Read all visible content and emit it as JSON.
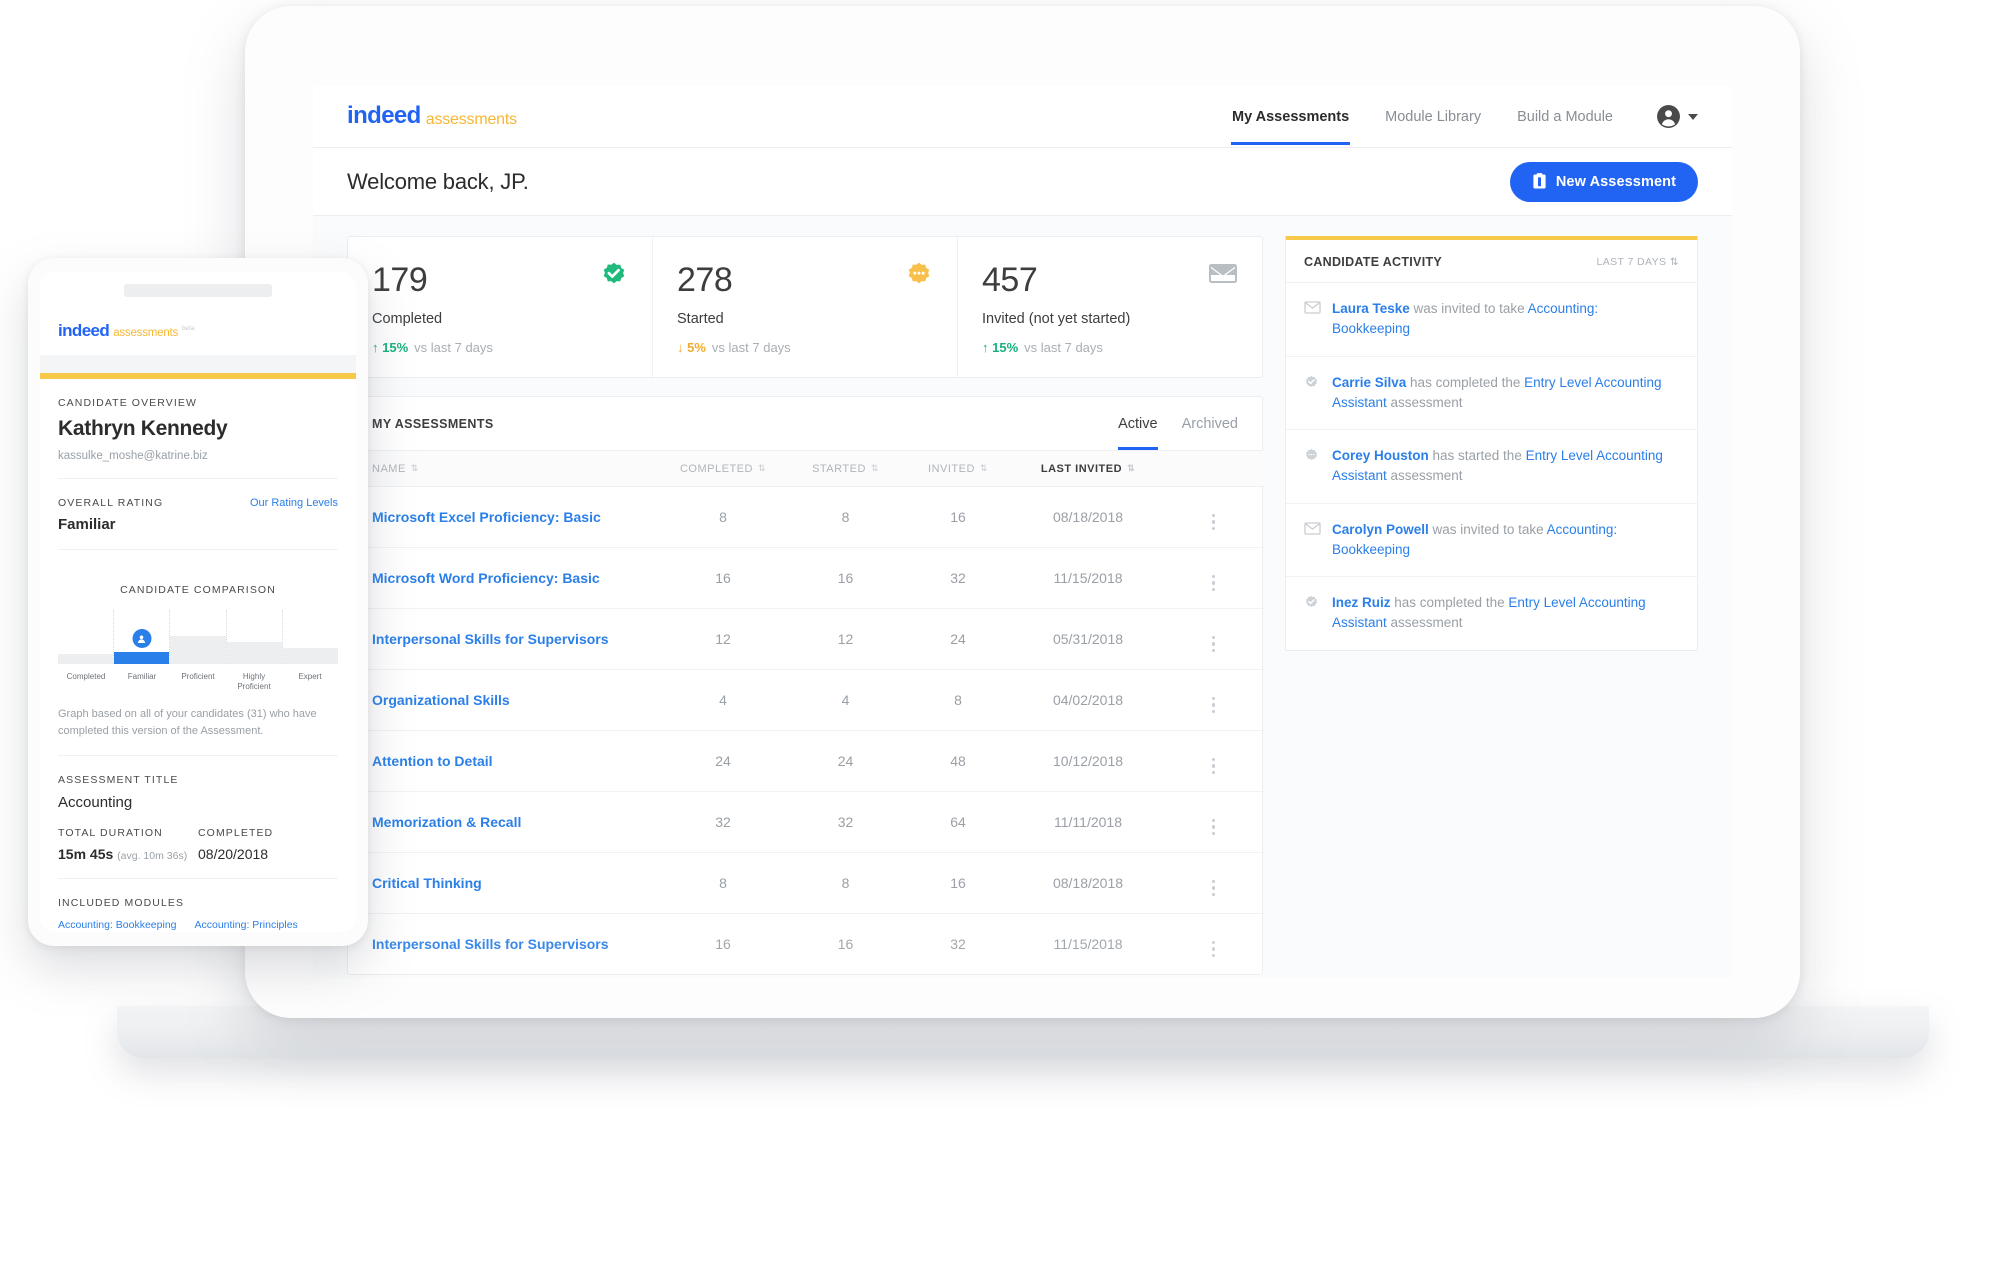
{
  "brand": {
    "indeed": "indeed",
    "assessments": "assessments",
    "beta": "beta",
    "blue": "#2164f3",
    "yellow": "#f7b733",
    "accent_yellow": "#f7c948",
    "link_blue": "#2a7fe8",
    "green": "#18b07b"
  },
  "nav": {
    "items": [
      {
        "label": "My Assessments",
        "active": true
      },
      {
        "label": "Module Library",
        "active": false
      },
      {
        "label": "Build a Module",
        "active": false
      }
    ],
    "avatar_icon": "account-circle-icon",
    "caret_icon": "chevron-down-icon"
  },
  "welcome": {
    "title": "Welcome back, JP.",
    "new_assessment_label": "New Assessment",
    "new_assessment_icon": "clipboard-icon"
  },
  "stats": [
    {
      "value": "179",
      "label": "Completed",
      "delta": "15%",
      "delta_dir": "up",
      "delta_arrow": "↑",
      "vs": "vs last 7 days",
      "badge_icon": "check-badge-icon",
      "badge_color": "#20ba7c"
    },
    {
      "value": "278",
      "label": "Started",
      "delta": "5%",
      "delta_dir": "down",
      "delta_arrow": "↓",
      "vs": "vs last 7 days",
      "badge_icon": "ellipsis-badge-icon",
      "badge_color": "#f7c04a"
    },
    {
      "value": "457",
      "label": "Invited (not yet started)",
      "delta": "15%",
      "delta_dir": "up",
      "delta_arrow": "↑",
      "vs": "vs last 7 days",
      "badge_icon": "envelope-icon",
      "badge_color": "#b9bec4"
    }
  ],
  "assessments_panel": {
    "title": "MY ASSESSMENTS",
    "tabs": [
      {
        "label": "Active",
        "active": true
      },
      {
        "label": "Archived",
        "active": false
      }
    ],
    "columns": [
      {
        "label": "NAME",
        "sorted": false
      },
      {
        "label": "COMPLETED",
        "sorted": false
      },
      {
        "label": "STARTED",
        "sorted": false
      },
      {
        "label": "INVITED",
        "sorted": false
      },
      {
        "label": "LAST INVITED",
        "sorted": true
      }
    ],
    "sort_icon": "⇅",
    "row_menu_icon": "kebab-menu-icon",
    "rows": [
      {
        "name": "Microsoft Excel Proficiency: Basic",
        "completed": "8",
        "started": "8",
        "invited": "16",
        "last_invited": "08/18/2018"
      },
      {
        "name": "Microsoft Word Proficiency: Basic",
        "completed": "16",
        "started": "16",
        "invited": "32",
        "last_invited": "11/15/2018"
      },
      {
        "name": "Interpersonal Skills for Supervisors",
        "completed": "12",
        "started": "12",
        "invited": "24",
        "last_invited": "05/31/2018"
      },
      {
        "name": "Organizational Skills",
        "completed": "4",
        "started": "4",
        "invited": "8",
        "last_invited": "04/02/2018"
      },
      {
        "name": "Attention to Detail",
        "completed": "24",
        "started": "24",
        "invited": "48",
        "last_invited": "10/12/2018"
      },
      {
        "name": "Memorization & Recall",
        "completed": "32",
        "started": "32",
        "invited": "64",
        "last_invited": "11/11/2018"
      },
      {
        "name": "Critical Thinking",
        "completed": "8",
        "started": "8",
        "invited": "16",
        "last_invited": "08/18/2018"
      },
      {
        "name": "Interpersonal Skills for Supervisors",
        "completed": "16",
        "started": "16",
        "invited": "32",
        "last_invited": "11/15/2018"
      }
    ]
  },
  "activity": {
    "title": "CANDIDATE ACTIVITY",
    "filter": "LAST 7 DAYS",
    "filter_icon": "⇅",
    "items": [
      {
        "icon": "envelope-icon",
        "person": "Laura Teske",
        "mid": " was invited to take ",
        "link": "Accounting: Bookkeeping",
        "tail": ""
      },
      {
        "icon": "check-badge-icon",
        "person": "Carrie Silva",
        "mid": " has completed the ",
        "link": "Entry Level Accounting Assistant",
        "tail": " assessment"
      },
      {
        "icon": "dots-badge-icon",
        "person": "Corey Houston",
        "mid": " has started the ",
        "link": "Entry Level Accounting Assistant",
        "tail": " assessment"
      },
      {
        "icon": "envelope-icon",
        "person": "Carolyn Powell",
        "mid": " was invited to take ",
        "link": "Accounting: Bookkeeping",
        "tail": ""
      },
      {
        "icon": "check-badge-icon",
        "person": "Inez Ruiz",
        "mid": " has completed the ",
        "link": "Entry Level Accounting Assistant",
        "tail": " assessment"
      }
    ]
  },
  "tablet": {
    "overview_caption": "CANDIDATE OVERVIEW",
    "candidate_name": "Kathryn Kennedy",
    "candidate_email": "kassulke_moshe@katrine.biz",
    "rating_caption": "OVERALL RATING",
    "rating_link": "Our Rating Levels",
    "rating_value": "Familiar",
    "comparison_title": "CANDIDATE COMPARISON",
    "comparison_note": "Graph based on all of your candidates (31) who have completed this version of the Assessment.",
    "marker_icon": "person-marker-icon",
    "title_caption": "ASSESSMENT TITLE",
    "title_value": "Accounting",
    "duration_caption": "TOTAL DURATION",
    "duration_value": "15m 45s",
    "duration_avg": "(avg. 10m 36s)",
    "completed_caption": "COMPLETED",
    "completed_value": "08/20/2018",
    "modules_caption": "INCLUDED MODULES",
    "modules": [
      "Accounting: Bookkeeping",
      "Accounting: Principles"
    ]
  },
  "chart_data": {
    "type": "bar",
    "title": "CANDIDATE COMPARISON",
    "categories": [
      "Completed",
      "Familiar",
      "Proficient",
      "Highly Proficient",
      "Expert"
    ],
    "values": [
      18,
      22,
      52,
      40,
      30
    ],
    "highlight_index": 1,
    "highlight_color": "#2a7fe8",
    "bar_color": "#edeeef",
    "ylabel": "",
    "xlabel": "",
    "ylim": [
      0,
      100
    ],
    "grid": false,
    "note": "Graph based on all of your candidates (31) who have completed this version of the Assessment."
  }
}
